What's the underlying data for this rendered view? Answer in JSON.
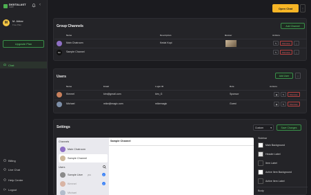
{
  "app": {
    "logo_text": "DIGITALAST",
    "logo_sub": "CHAT"
  },
  "user": {
    "initial": "M",
    "name": "M. Akbar",
    "plan": "Free Plan"
  },
  "sidebar": {
    "upgrade_label": "Upgrade Plan",
    "items": [
      {
        "label": "Chat",
        "icon": "chat-icon",
        "active": true
      },
      {
        "label": "Billing",
        "icon": "billing-icon"
      },
      {
        "label": "Live Chat",
        "icon": "live-chat-icon"
      },
      {
        "label": "Help Center",
        "icon": "help-icon"
      },
      {
        "label": "Logout",
        "icon": "logout-icon"
      }
    ]
  },
  "header": {
    "open_chat_label": "Open Chat",
    "more_label": "⋮"
  },
  "group_channels": {
    "title": "Group Channels",
    "add_label": "Add Channel",
    "columns": [
      "Name",
      "Description",
      "Banner",
      "Actions"
    ],
    "rows": [
      {
        "name": "Main Chatroom",
        "description": "Kedai Kopi",
        "has_banner": true
      },
      {
        "name": "Sample Channel",
        "description": "",
        "has_banner": false
      }
    ]
  },
  "users": {
    "title": "Users",
    "add_label": "Add User",
    "columns": [
      "Name",
      "Email",
      "Login ID",
      "Role",
      "Actions"
    ],
    "rows": [
      {
        "name": "Kimmel",
        "email": "kim@gmail.com",
        "login_id": "kim_G",
        "role": "Sponsor"
      },
      {
        "name": "Michael",
        "email": "mike@magic.com",
        "login_id": "mikemagic",
        "role": "Guest"
      }
    ]
  },
  "actions": {
    "remove_label": "Remove"
  },
  "settings": {
    "title": "Settings",
    "theme_value": "Custom",
    "save_label": "Save Changes",
    "preview": {
      "channels_header": "Channels",
      "channels": [
        "Main Chatroom",
        "Sample Channel"
      ],
      "users_header": "Users",
      "users": [
        {
          "name": "Sample User",
          "suffix": "you"
        },
        {
          "name": "Kimmel",
          "suffix": ""
        },
        {
          "name": "Michael",
          "suffix": ""
        }
      ],
      "active_channel": "Sample Channel"
    },
    "panel": {
      "sidebar_header": "Sidebar",
      "options": [
        "Main Background",
        "Header Label",
        "Item Label",
        "Active Item Background",
        "Active Item Label"
      ],
      "body_header": "Body"
    }
  },
  "colors": {
    "accent": "#f6b526",
    "green": "#5fd36f",
    "danger": "#ef6a6a",
    "check": "#3b82f6"
  }
}
